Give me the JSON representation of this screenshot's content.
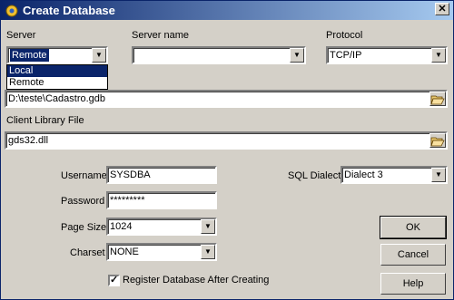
{
  "window": {
    "title": "Create Database",
    "close_label": "✕"
  },
  "server": {
    "label": "Server",
    "value": "Remote",
    "options": [
      "Local",
      "Remote"
    ],
    "highlighted_option": "Local"
  },
  "server_name": {
    "label": "Server name",
    "value": ""
  },
  "protocol": {
    "label": "Protocol",
    "value": "TCP/IP"
  },
  "database": {
    "value": "D:\\teste\\Cadastro.gdb"
  },
  "client_library": {
    "label": "Client Library File",
    "value": "gds32.dll"
  },
  "username": {
    "label": "Username",
    "value": "SYSDBA"
  },
  "password": {
    "label": "Password",
    "value": "*********"
  },
  "page_size": {
    "label": "Page Size",
    "value": "1024"
  },
  "charset": {
    "label": "Charset",
    "value": "NONE"
  },
  "sql_dialect": {
    "label": "SQL Dialect",
    "value": "Dialect 3"
  },
  "register": {
    "label": "Register Database After Creating",
    "checked": true,
    "check_glyph": "✓"
  },
  "buttons": {
    "ok": "OK",
    "cancel": "Cancel",
    "help": "Help"
  },
  "icons": {
    "dropdown": "▼",
    "folder": "folder-open-icon",
    "app": "database-app-icon"
  }
}
